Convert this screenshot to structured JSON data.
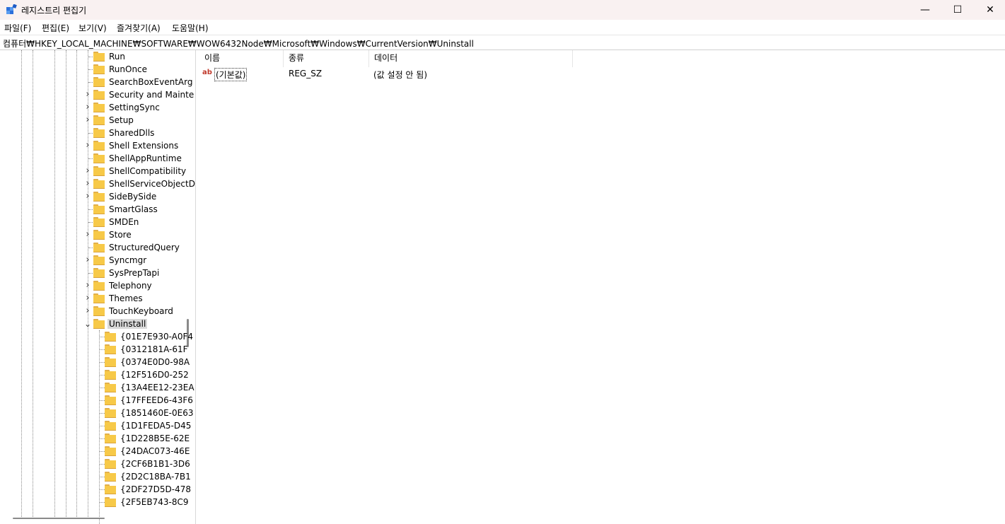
{
  "window": {
    "title": "레지스트리 편집기",
    "minimize_glyph": "—",
    "maximize_glyph": "☐",
    "close_glyph": "✕"
  },
  "menu": [
    "파일(F)",
    "편집(E)",
    "보기(V)",
    "즐겨찾기(A)",
    "도움말(H)"
  ],
  "address": "컴퓨터₩HKEY_LOCAL_MACHINE₩SOFTWARE₩WOW6432Node₩Microsoft₩Windows₩CurrentVersion₩Uninstall",
  "tree": {
    "items": [
      {
        "label": "Run",
        "expandable": false
      },
      {
        "label": "RunOnce",
        "expandable": false
      },
      {
        "label": "SearchBoxEventArg",
        "expandable": false
      },
      {
        "label": "Security and Mainte",
        "expandable": true
      },
      {
        "label": "SettingSync",
        "expandable": true
      },
      {
        "label": "Setup",
        "expandable": true
      },
      {
        "label": "SharedDlls",
        "expandable": false
      },
      {
        "label": "Shell Extensions",
        "expandable": true
      },
      {
        "label": "ShellAppRuntime",
        "expandable": false
      },
      {
        "label": "ShellCompatibility",
        "expandable": true
      },
      {
        "label": "ShellServiceObjectD",
        "expandable": true
      },
      {
        "label": "SideBySide",
        "expandable": true
      },
      {
        "label": "SmartGlass",
        "expandable": false
      },
      {
        "label": "SMDEn",
        "expandable": false
      },
      {
        "label": "Store",
        "expandable": true
      },
      {
        "label": "StructuredQuery",
        "expandable": false
      },
      {
        "label": "Syncmgr",
        "expandable": true
      },
      {
        "label": "SysPrepTapi",
        "expandable": false
      },
      {
        "label": "Telephony",
        "expandable": true
      },
      {
        "label": "Themes",
        "expandable": true
      },
      {
        "label": "TouchKeyboard",
        "expandable": true
      },
      {
        "label": "Uninstall",
        "expandable": true,
        "expanded": true,
        "selected": true
      }
    ],
    "children": [
      "{01E7E930-A0F4",
      "{0312181A-61F",
      "{0374E0D0-98A",
      "{12F516D0-252",
      "{13A4EE12-23EA",
      "{17FFEED6-43F6",
      "{1851460E-0E63",
      "{1D1FEDA5-D45",
      "{1D228B5E-62E",
      "{24DAC073-46E",
      "{2CF6B1B1-3D6",
      "{2D2C18BA-7B1",
      "{2DF27D5D-478",
      "{2F5EB743-8C9"
    ]
  },
  "list": {
    "headers": {
      "name": "이름",
      "type": "종류",
      "data": "데이터"
    },
    "rows": [
      {
        "icon": "ab",
        "name": "(기본값)",
        "type": "REG_SZ",
        "data": "(값 설정 안 됨)"
      }
    ]
  },
  "colors": {
    "folder": "#f7c948",
    "selection": "#d9d9d9",
    "titlebar": "#f9f1f1"
  }
}
